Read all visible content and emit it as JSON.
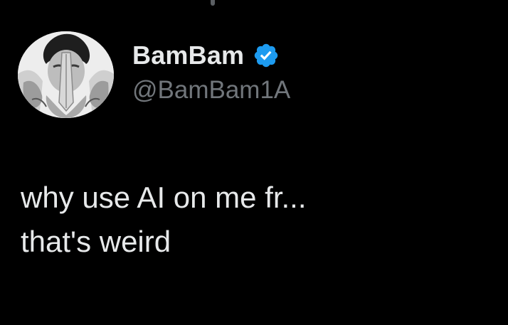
{
  "tweet": {
    "author": {
      "display_name": "BamBam",
      "handle": "@BamBam1A",
      "verified": true,
      "verified_icon": "verified-badge-icon",
      "avatar_icon": "avatar-photo"
    },
    "text_lines": [
      "why use AI on me fr...",
      "that's weird"
    ]
  },
  "colors": {
    "background": "#000000",
    "primary_text": "#e7e9ea",
    "secondary_text": "#71767b",
    "verified_blue": "#1d9bf0"
  }
}
